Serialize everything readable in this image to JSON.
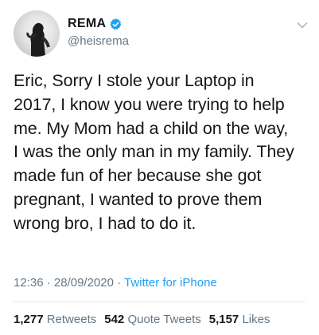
{
  "author": {
    "display_name": "REMA",
    "handle": "@heisrema",
    "verified": true,
    "avatar_icon": "profile-photo-icon"
  },
  "tweet": {
    "text": "Eric, Sorry I stole your Laptop in\n2017, I know you were trying to help\nme. My Mom had a child on the way,\nI was the only man in my family. They\nmade fun of her because she got\npregnant, I wanted to prove them\nwrong bro, I had to do it.",
    "time": "12:36",
    "date": "28/09/2020",
    "separator": "·",
    "source": "Twitter for iPhone"
  },
  "stats": {
    "retweets_count": "1,277",
    "retweets_label": "Retweets",
    "quote_count": "542",
    "quote_label": "Quote Tweets",
    "likes_count": "5,157",
    "likes_label": "Likes"
  },
  "colors": {
    "verified_badge": "#1da1f2",
    "link": "#1da1f2",
    "secondary_text": "#657786",
    "primary_text": "#14171a"
  }
}
